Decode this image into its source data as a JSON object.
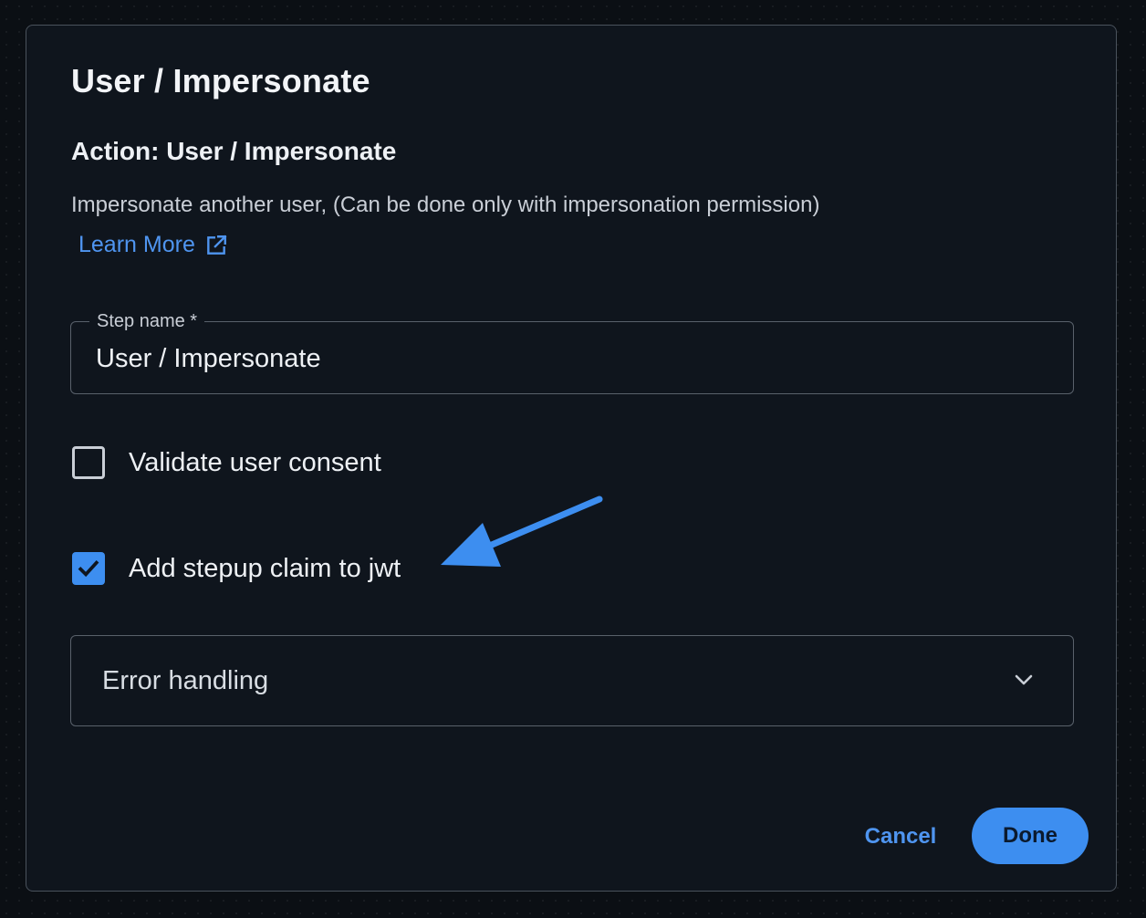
{
  "dialog": {
    "title": "User / Impersonate",
    "action_title": "Action: User / Impersonate",
    "description": "Impersonate another user, (Can be done only with impersonation permission)",
    "learn_more": {
      "label": "Learn More",
      "icon": "external-link-icon"
    }
  },
  "step_name": {
    "label": "Step name *",
    "value": "User / Impersonate"
  },
  "options": {
    "validate_consent": {
      "label": "Validate user consent",
      "checked": false
    },
    "stepup_claim": {
      "label": "Add stepup claim to jwt",
      "checked": true
    }
  },
  "error_handling": {
    "label": "Error handling",
    "icon": "chevron-down-icon"
  },
  "annotation": {
    "icon": "arrow-pointer-icon",
    "color": "#3d8ef0"
  },
  "footer": {
    "cancel_label": "Cancel",
    "done_label": "Done"
  },
  "colors": {
    "accent": "#3d8ef0",
    "link": "#4f95f0",
    "background": "#0f151d"
  }
}
